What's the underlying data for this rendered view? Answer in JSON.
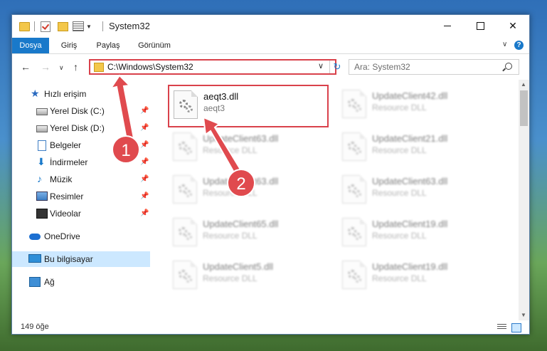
{
  "window": {
    "title": "System32"
  },
  "ribbon": {
    "tabs": [
      "Dosya",
      "Giriş",
      "Paylaş",
      "Görünüm"
    ]
  },
  "address": {
    "path": "C:\\Windows\\System32"
  },
  "search": {
    "placeholder": "Ara: System32"
  },
  "sidebar": {
    "items": [
      {
        "label": "Hızlı erişim",
        "icon": "star-icon"
      },
      {
        "label": "Yerel Disk (C:)",
        "icon": "drive-icon"
      },
      {
        "label": "Yerel Disk (D:)",
        "icon": "drive-icon"
      },
      {
        "label": "Belgeler",
        "icon": "documents-icon"
      },
      {
        "label": "İndirmeler",
        "icon": "download-icon"
      },
      {
        "label": "Müzik",
        "icon": "music-icon"
      },
      {
        "label": "Resimler",
        "icon": "pictures-icon"
      },
      {
        "label": "Videolar",
        "icon": "video-icon"
      },
      {
        "label": "OneDrive",
        "icon": "cloud-icon"
      },
      {
        "label": "Bu bilgisayar",
        "icon": "computer-icon"
      },
      {
        "label": "Ağ",
        "icon": "network-icon"
      }
    ]
  },
  "files": [
    {
      "name": "aeqt3.dll",
      "type": "aeqt3"
    },
    {
      "name": "UpdateClient42.dll",
      "type": "Resource DLL"
    },
    {
      "name": "UpdateClient63.dll",
      "type": "Resource DLL"
    },
    {
      "name": "UpdateClient21.dll",
      "type": "Resource DLL"
    },
    {
      "name": "UpdateClient63.dll",
      "type": "Resource DLL"
    },
    {
      "name": "UpdateClient63.dll",
      "type": "Resource DLL"
    },
    {
      "name": "UpdateClient65.dll",
      "type": "Resource DLL"
    },
    {
      "name": "UpdateClient19.dll",
      "type": "Resource DLL"
    },
    {
      "name": "UpdateClient5.dll",
      "type": "Resource DLL"
    },
    {
      "name": "UpdateClient19.dll",
      "type": "Resource DLL"
    }
  ],
  "status": {
    "item_count": "149 öğe"
  },
  "annotations": {
    "step1": "1",
    "step2": "2",
    "color": "#e04a4e"
  }
}
